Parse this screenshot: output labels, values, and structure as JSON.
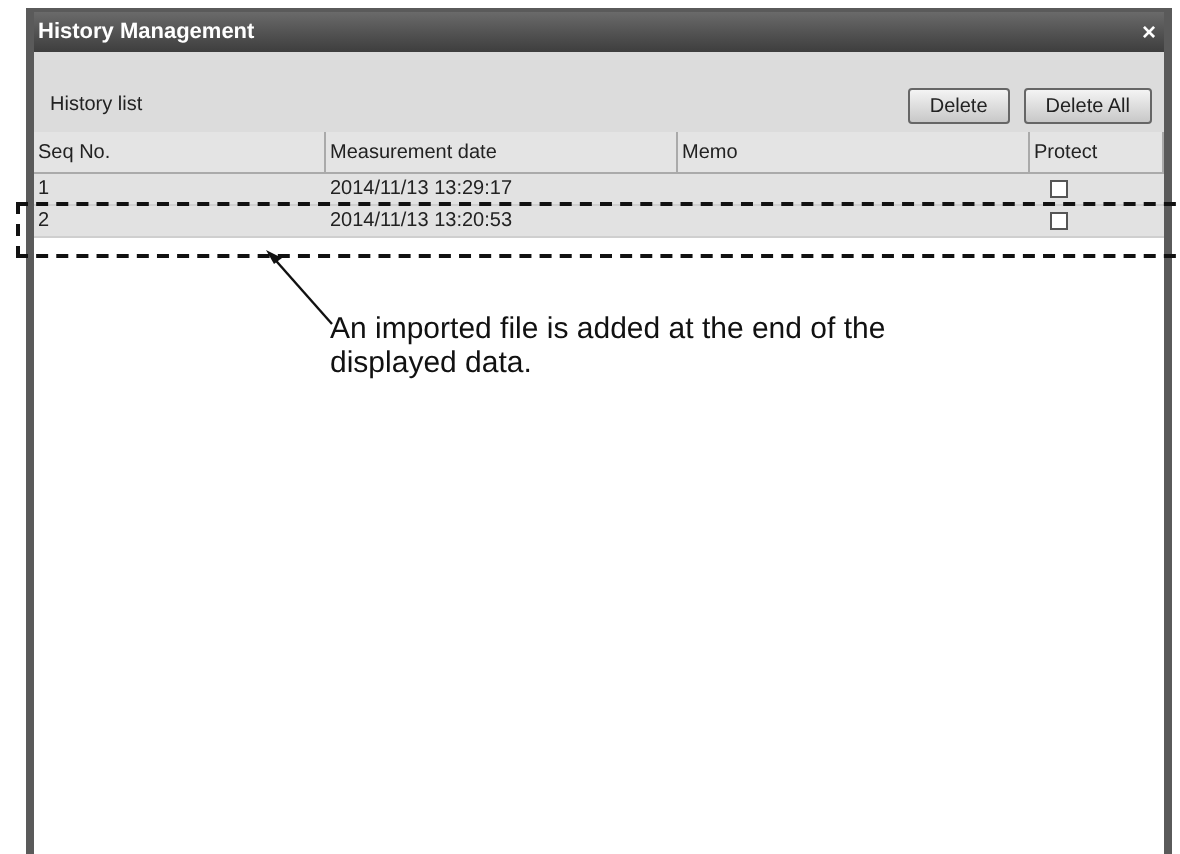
{
  "window": {
    "title": "History Management",
    "close": "×"
  },
  "section_label": "History list",
  "buttons": [
    "Delete",
    "Delete All"
  ],
  "table": {
    "columns": [
      "Seq No.",
      "Measurement date",
      "Memo",
      "Protect"
    ],
    "rows": [
      {
        "seq": "1",
        "date": "2014/11/13 13:29:17",
        "protected": false
      },
      {
        "seq": "2",
        "date": "2014/11/13 13:20:53",
        "protected": false
      }
    ]
  },
  "annotation": {
    "text": "An imported file is added at the end of the displayed data."
  }
}
